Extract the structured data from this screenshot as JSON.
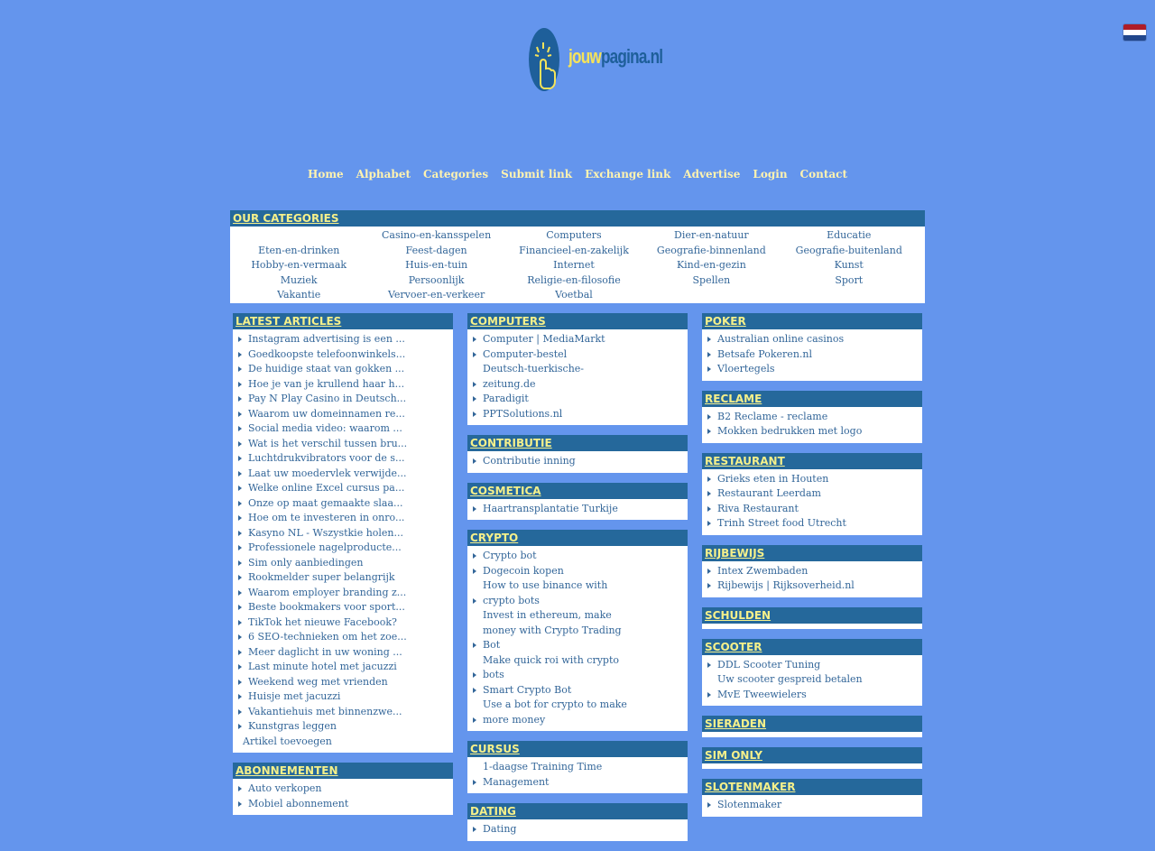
{
  "logo": {
    "text_a": "jouw",
    "text_b": "pagina.nl"
  },
  "colors": {
    "background": "#6495ED",
    "header": "#25689B",
    "link": "#336699",
    "nav": "#FFF3B0",
    "heading_text": "#F5F08A"
  },
  "flag": {
    "colors": [
      "#AE1C28",
      "#FFFFFF",
      "#21468B"
    ]
  },
  "nav": [
    "Home",
    "Alphabet",
    "Categories",
    "Submit link",
    "Exchange link",
    "Advertise",
    "Login",
    "Contact"
  ],
  "categories": {
    "title": "OUR CATEGORIES",
    "items": [
      "",
      "Casino-en-kansspelen",
      "Computers",
      "Dier-en-natuur",
      "Educatie",
      "Eten-en-drinken",
      "Feest-dagen",
      "Financieel-en-zakelijk",
      "Geografie-binnenland",
      "Geografie-buitenland",
      "Hobby-en-vermaak",
      "Huis-en-tuin",
      "Internet",
      "Kind-en-gezin",
      "Kunst",
      "Muziek",
      "Persoonlijk",
      "Religie-en-filosofie",
      "Spellen",
      "Sport",
      "Vakantie",
      "Vervoer-en-verkeer",
      "Voetbal"
    ]
  },
  "columns": [
    [
      {
        "title": "LATEST ARTICLES",
        "items": [
          {
            "t": "Instagram advertising is een ...",
            "a": 1
          },
          {
            "t": "Goedkoopste telefoonwinkels...",
            "a": 1
          },
          {
            "t": "De huidige staat van gokken ...",
            "a": 1
          },
          {
            "t": "Hoe je van je krullend haar h...",
            "a": 1
          },
          {
            "t": "Pay N Play Casino in Deutsch...",
            "a": 1
          },
          {
            "t": "Waarom uw domeinnamen re...",
            "a": 1
          },
          {
            "t": "Social media video: waarom ...",
            "a": 1
          },
          {
            "t": "Wat is het verschil tussen bru...",
            "a": 1
          },
          {
            "t": "Luchtdrukvibrators voor de s...",
            "a": 1
          },
          {
            "t": "Laat uw moedervlek verwijde...",
            "a": 1
          },
          {
            "t": "Welke online Excel cursus pa...",
            "a": 1
          },
          {
            "t": "Onze op maat gemaakte slaa...",
            "a": 1
          },
          {
            "t": "Hoe om te investeren in onro...",
            "a": 1
          },
          {
            "t": "Kasyno NL - Wszystkie holen...",
            "a": 1
          },
          {
            "t": "Professionele nagelproducte...",
            "a": 1
          },
          {
            "t": "Sim only aanbiedingen",
            "a": 1
          },
          {
            "t": "Rookmelder super belangrijk",
            "a": 1
          },
          {
            "t": "Waarom employer branding z...",
            "a": 1
          },
          {
            "t": "Beste bookmakers voor sport...",
            "a": 1
          },
          {
            "t": "TikTok het nieuwe Facebook?",
            "a": 1
          },
          {
            "t": "6 SEO-technieken om het zoe...",
            "a": 1
          },
          {
            "t": "Meer daglicht in uw woning ...",
            "a": 1
          },
          {
            "t": "Last minute hotel met jacuzzi",
            "a": 1
          },
          {
            "t": "Weekend weg met vrienden",
            "a": 1
          },
          {
            "t": "Huisje met jacuzzi",
            "a": 1
          },
          {
            "t": "Vakantiehuis met binnenzwe...",
            "a": 1
          },
          {
            "t": "Kunstgras leggen",
            "a": 1
          },
          {
            "t": "Artikel toevoegen",
            "a": 2
          }
        ]
      },
      {
        "title": "ABONNEMENTEN",
        "items": [
          {
            "t": "Auto verkopen",
            "a": 1
          },
          {
            "t": "Mobiel abonnement",
            "a": 1
          }
        ]
      }
    ],
    [
      {
        "title": "COMPUTERS",
        "items": [
          {
            "t": "Computer | MediaMarkt",
            "a": 1
          },
          {
            "t": "Computer-bestel",
            "a": 1
          },
          {
            "t": "Deutsch-tuerkische-",
            "a": 0
          },
          {
            "t": "zeitung.de",
            "a": 1
          },
          {
            "t": "Paradigit",
            "a": 1
          },
          {
            "t": "PPTSolutions.nl",
            "a": 1
          }
        ]
      },
      {
        "title": "CONTRIBUTIE",
        "items": [
          {
            "t": "Contributie inning",
            "a": 1
          }
        ]
      },
      {
        "title": "COSMETICA",
        "items": [
          {
            "t": "Haartransplantatie Turkije",
            "a": 1
          }
        ]
      },
      {
        "title": "CRYPTO",
        "items": [
          {
            "t": "Crypto bot",
            "a": 1
          },
          {
            "t": "Dogecoin kopen",
            "a": 1
          },
          {
            "t": "How to use binance with",
            "a": 0
          },
          {
            "t": "crypto bots",
            "a": 1
          },
          {
            "t": "Invest in ethereum, make",
            "a": 0
          },
          {
            "t": "money with Crypto Trading",
            "a": 0
          },
          {
            "t": "Bot",
            "a": 1
          },
          {
            "t": "Make quick roi with crypto",
            "a": 0
          },
          {
            "t": "bots",
            "a": 1
          },
          {
            "t": "Smart Crypto Bot",
            "a": 1
          },
          {
            "t": "Use a bot for crypto to make",
            "a": 0
          },
          {
            "t": "more money",
            "a": 1
          }
        ]
      },
      {
        "title": "CURSUS",
        "items": [
          {
            "t": "1-daagse Training Time",
            "a": 0
          },
          {
            "t": "Management",
            "a": 1
          }
        ]
      },
      {
        "title": "DATING",
        "items": [
          {
            "t": "Dating",
            "a": 1
          }
        ]
      }
    ],
    [
      {
        "title": "POKER",
        "items": [
          {
            "t": "Australian online casinos",
            "a": 1
          },
          {
            "t": "Betsafe Pokeren.nl",
            "a": 1
          },
          {
            "t": "Vloertegels",
            "a": 1
          }
        ]
      },
      {
        "title": "RECLAME",
        "items": [
          {
            "t": "B2 Reclame - reclame",
            "a": 1
          },
          {
            "t": "Mokken bedrukken met logo",
            "a": 1
          }
        ]
      },
      {
        "title": "RESTAURANT",
        "items": [
          {
            "t": "Grieks eten in Houten",
            "a": 1
          },
          {
            "t": "Restaurant Leerdam",
            "a": 1
          },
          {
            "t": "Riva Restaurant",
            "a": 1
          },
          {
            "t": "Trinh Street food Utrecht",
            "a": 1
          }
        ]
      },
      {
        "title": "RIJBEWIJS",
        "items": [
          {
            "t": "Intex Zwembaden",
            "a": 1
          },
          {
            "t": "Rijbewijs | Rijksoverheid.nl",
            "a": 1
          }
        ]
      },
      {
        "title": "SCHULDEN",
        "items": []
      },
      {
        "title": "SCOOTER",
        "items": [
          {
            "t": "DDL Scooter Tuning",
            "a": 1
          },
          {
            "t": "Uw scooter gespreid betalen",
            "a": 0
          },
          {
            "t": "MvE Tweewielers",
            "a": 1
          }
        ]
      },
      {
        "title": "SIERADEN",
        "items": []
      },
      {
        "title": "SIM ONLY",
        "items": []
      },
      {
        "title": "SLOTENMAKER",
        "items": [
          {
            "t": "Slotenmaker",
            "a": 1
          }
        ]
      }
    ]
  ]
}
